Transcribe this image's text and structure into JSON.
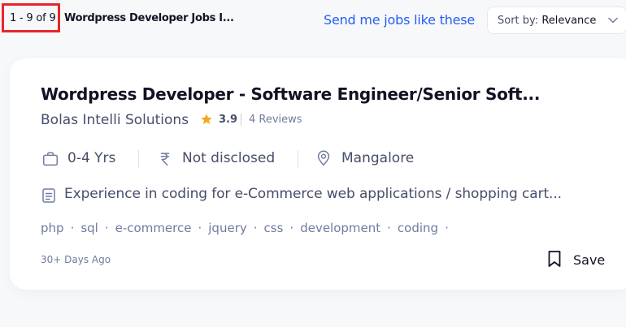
{
  "header": {
    "count": "1 - 9 of 9",
    "heading": "Wordpress Developer Jobs I...",
    "send_jobs_label": "Send me jobs like these",
    "sort_prefix": "Sort by:",
    "sort_value": "Relevance"
  },
  "job": {
    "title": "Wordpress Developer - Software Engineer/Senior Soft...",
    "company": "Bolas Intelli Solutions",
    "rating": "3.9",
    "reviews": "4 Reviews",
    "experience": "0-4 Yrs",
    "salary": "Not disclosed",
    "location": "Mangalore",
    "description": "Experience in coding for e-Commerce web applications / shopping cart...",
    "tags": [
      "php",
      "sql",
      "e-commerce",
      "jquery",
      "css",
      "development",
      "coding"
    ],
    "posted": "30+ Days Ago",
    "save_label": "Save"
  },
  "colors": {
    "accent": "#275df5",
    "highlight_box": "#e8262b",
    "star": "#f5a623"
  },
  "icons": {
    "experience": "briefcase-icon",
    "salary": "rupee-icon",
    "location": "location-pin-icon",
    "description": "document-icon",
    "rating": "star-icon",
    "save": "bookmark-icon",
    "sort": "chevron-down-icon"
  }
}
